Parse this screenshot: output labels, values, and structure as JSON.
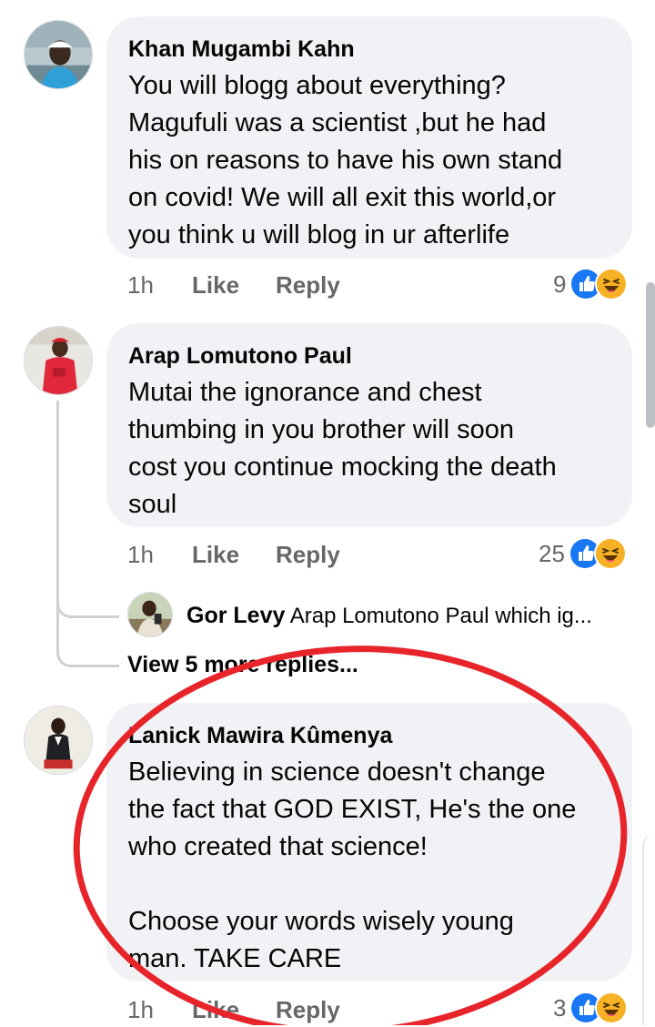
{
  "comments": [
    {
      "author": "Khan Mugambi Kahn",
      "lines": [
        "You will blogg about everything?",
        "Magufuli was a scientist ,but he had",
        "his on reasons to have his own stand",
        "on covid! We will all exit this world,or",
        "you think u will blog in ur afterlife"
      ],
      "time": "1h",
      "like_label": "Like",
      "reply_label": "Reply",
      "reaction_count": "9",
      "reactions": [
        "like-icon",
        "haha-icon"
      ]
    },
    {
      "author": "Arap Lomutono Paul",
      "lines": [
        "Mutai the ignorance and chest",
        "thumbing in you brother will soon",
        "cost you continue mocking the death",
        "soul"
      ],
      "time": "1h",
      "like_label": "Like",
      "reply_label": "Reply",
      "reaction_count": "25",
      "reactions": [
        "like-icon",
        "haha-icon"
      ],
      "reply_preview": {
        "author": "Gor Levy",
        "text": "Arap Lomutono Paul which ig..."
      },
      "view_more_label": "View 5 more replies..."
    },
    {
      "author": "Lanick Mawira Kûmenya",
      "lines": [
        "Believing in science doesn't change",
        "the fact that GOD EXIST, He's the one",
        "who created that science!",
        "",
        "Choose your words wisely young",
        "man. TAKE CARE"
      ],
      "time": "1h",
      "like_label": "Like",
      "reply_label": "Reply",
      "reaction_count": "3",
      "reactions": [
        "like-icon",
        "haha-icon"
      ]
    }
  ],
  "colors": {
    "bubble": "#f0f2f5",
    "meta_text": "#65676b",
    "like_blue": "#1877f2",
    "haha_yellow": "#f7b125",
    "annotation_red": "#e8242b"
  }
}
